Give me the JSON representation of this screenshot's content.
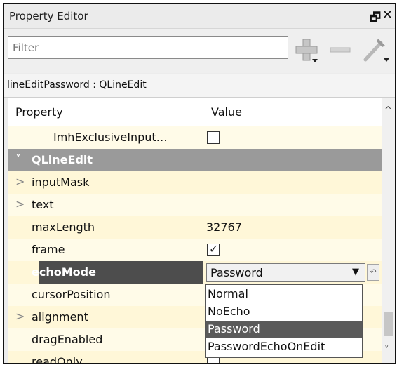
{
  "panel": {
    "title": "Property Editor",
    "float_icon": "float-window-icon",
    "close_icon": "close-icon"
  },
  "filter": {
    "placeholder": "Filter",
    "add_icon": "plus-icon",
    "remove_icon": "minus-icon",
    "configure_icon": "wrench-icon"
  },
  "object_label": "lineEditPassword : QLineEdit",
  "table": {
    "headers": {
      "property": "Property",
      "value": "Value"
    },
    "rows": [
      {
        "name": "ImhExclusiveInput…",
        "type": "checkbox",
        "checked": false
      },
      {
        "name": "QLineEdit",
        "type": "group"
      },
      {
        "name": "inputMask",
        "type": "expandable",
        "value": ""
      },
      {
        "name": "text",
        "type": "expandable",
        "value": ""
      },
      {
        "name": "maxLength",
        "type": "text",
        "value": "32767"
      },
      {
        "name": "frame",
        "type": "checkbox",
        "checked": true
      },
      {
        "name": "echoMode",
        "type": "combo",
        "value": "Password"
      },
      {
        "name": "cursorPosition",
        "type": "text",
        "value": ""
      },
      {
        "name": "alignment",
        "type": "expandable",
        "value": ""
      },
      {
        "name": "dragEnabled",
        "type": "text",
        "value": ""
      },
      {
        "name": "readOnly",
        "type": "checkbox",
        "checked": false
      }
    ]
  },
  "echo_dropdown": {
    "options": [
      "Normal",
      "NoEcho",
      "Password",
      "PasswordEchoOnEdit"
    ],
    "selected": "Password"
  },
  "glyphs": {
    "collapse": "˅",
    "expand": ">",
    "dropdown_arrow": "▼",
    "reset": "↶",
    "float": "🗗",
    "close": "✕",
    "check": "✓",
    "scroll_up": "^",
    "scroll_down": "˅"
  },
  "colors": {
    "group_row": "#9a9a9a",
    "selected_name": "#4d4d4d",
    "row_yellow": "#fff7d8"
  }
}
